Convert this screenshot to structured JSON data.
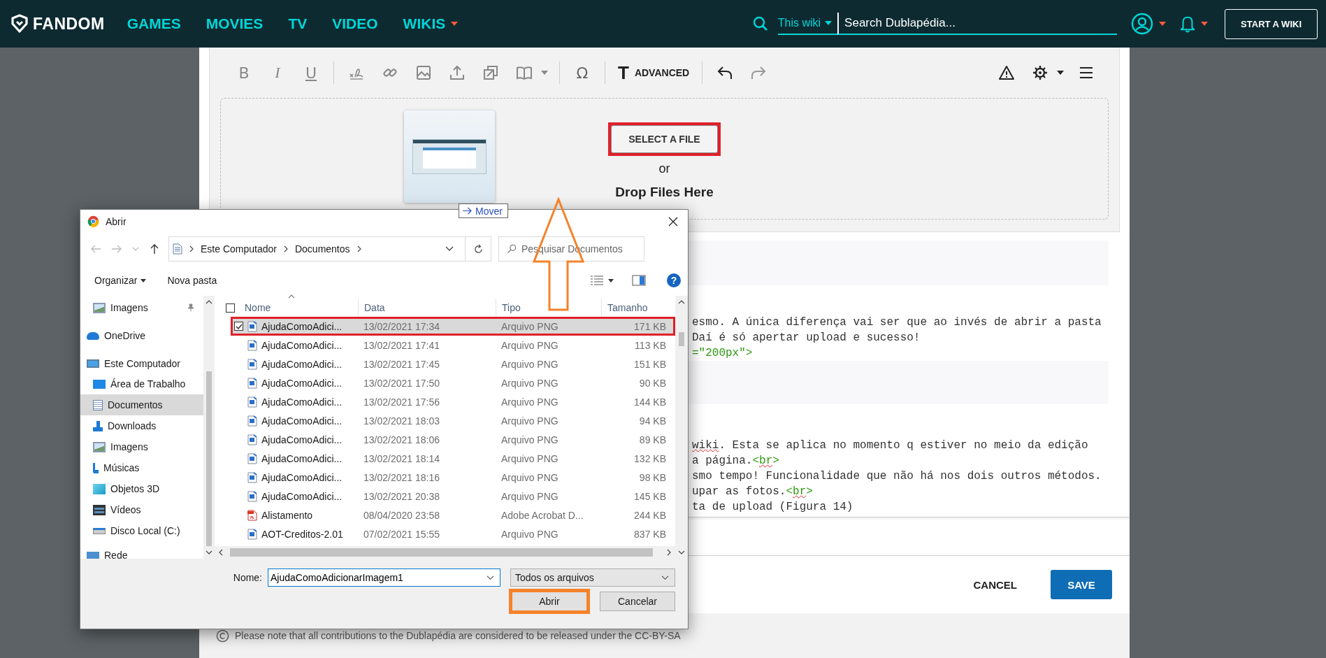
{
  "nav": {
    "logo": "FANDOM",
    "links": [
      {
        "label": "GAMES",
        "dropdown": false
      },
      {
        "label": "MOVIES",
        "dropdown": false
      },
      {
        "label": "TV",
        "dropdown": false
      },
      {
        "label": "VIDEO",
        "dropdown": false
      },
      {
        "label": "WIKIS",
        "dropdown": true
      }
    ],
    "search_scope": "This wiki",
    "search_placeholder": "Search Dublapédia...",
    "start_button": "START A WIKI"
  },
  "toolbar": {
    "format": [
      {
        "label": "B",
        "kind": "bold"
      },
      {
        "label": "I",
        "kind": "italic"
      },
      {
        "label": "U",
        "kind": "underline"
      }
    ],
    "special": "Ω",
    "advanced_icon": "T",
    "advanced": "ADVANCED"
  },
  "upload": {
    "button": "SELECT A FILE",
    "highlighted": true,
    "or": "or",
    "drop": "Drop Files Here",
    "drag_tooltip": "Mover"
  },
  "editor": {
    "groups": [
      [
        {
          "segments": [
            {
              "text": "esmo. A única diferença vai ser que ao invés de abrir a pasta",
              "kind": "plain"
            }
          ]
        },
        {
          "segments": [
            {
              "text": "Daí é só apertar upload e sucesso!",
              "kind": "plain"
            }
          ]
        },
        {
          "segments": [
            {
              "text": "=\"200px\">",
              "kind": "tag"
            }
          ]
        }
      ],
      [
        {
          "segments": [
            {
              "text": "wiki",
              "kind": "misspelled"
            },
            {
              "text": ". Esta se aplica no momento q estiver no meio da edição",
              "kind": "plain"
            }
          ]
        },
        {
          "segments": [
            {
              "text": "a página.",
              "kind": "plain"
            },
            {
              "text": "<",
              "kind": "tag"
            },
            {
              "text": "br",
              "kind": "tag-misspelled"
            },
            {
              "text": ">",
              "kind": "tag"
            }
          ]
        },
        {
          "segments": [
            {
              "text": "smo tempo! Funcionalidade que não há nos dois outros métodos.",
              "kind": "plain"
            }
          ]
        },
        {
          "segments": [
            {
              "text": "upar as fotos.",
              "kind": "plain"
            },
            {
              "text": "<",
              "kind": "tag"
            },
            {
              "text": "br",
              "kind": "tag-misspelled"
            },
            {
              "text": ">",
              "kind": "tag"
            }
          ]
        },
        {
          "segments": [
            {
              "text": "ta de upload (Figura 14)",
              "kind": "plain"
            }
          ]
        }
      ]
    ]
  },
  "actions": {
    "cancel": "CANCEL",
    "save": "SAVE"
  },
  "legal": "Please note that all contributions to the Dublapédia are considered to be released under the CC-BY-SA",
  "dialog": {
    "title": "Abrir",
    "breadcrumb": [
      "Este Computador",
      "Documentos"
    ],
    "search_placeholder": "Pesquisar Documentos",
    "commands": [
      {
        "label": "Organizar",
        "dropdown": true
      },
      {
        "label": "Nova pasta",
        "dropdown": false
      }
    ],
    "help": "?",
    "nav_pane": [
      {
        "label": "Imagens",
        "kind": "pictures",
        "pinned": true,
        "selected": false
      },
      {
        "label": "OneDrive",
        "kind": "cloud",
        "pinned": false,
        "selected": false
      },
      {
        "label": "Este Computador",
        "kind": "computer",
        "pinned": false,
        "selected": false,
        "children": [
          {
            "label": "Área de Trabalho",
            "kind": "desktop",
            "selected": false
          },
          {
            "label": "Documentos",
            "kind": "documents",
            "selected": true
          },
          {
            "label": "Downloads",
            "kind": "downloads",
            "selected": false
          },
          {
            "label": "Imagens",
            "kind": "pictures",
            "selected": false
          },
          {
            "label": "Músicas",
            "kind": "music",
            "selected": false
          },
          {
            "label": "Objetos 3D",
            "kind": "objects3d",
            "selected": false
          },
          {
            "label": "Vídeos",
            "kind": "videos",
            "selected": false
          },
          {
            "label": "Disco Local (C:)",
            "kind": "disk",
            "selected": false
          }
        ]
      },
      {
        "label": "Rede",
        "kind": "network",
        "pinned": false,
        "selected": false
      }
    ],
    "columns": [
      "Nome",
      "Data",
      "Tipo",
      "Tamanho"
    ],
    "select_all_checked": false,
    "files": [
      {
        "name": "AjudaComoAdici...",
        "date": "13/02/2021 17:34",
        "type": "Arquivo PNG",
        "size": "171 KB",
        "kind": "png",
        "selected": true
      },
      {
        "name": "AjudaComoAdici...",
        "date": "13/02/2021 17:41",
        "type": "Arquivo PNG",
        "size": "113 KB",
        "kind": "png",
        "selected": false
      },
      {
        "name": "AjudaComoAdici...",
        "date": "13/02/2021 17:45",
        "type": "Arquivo PNG",
        "size": "151 KB",
        "kind": "png",
        "selected": false
      },
      {
        "name": "AjudaComoAdici...",
        "date": "13/02/2021 17:50",
        "type": "Arquivo PNG",
        "size": "90 KB",
        "kind": "png",
        "selected": false
      },
      {
        "name": "AjudaComoAdici...",
        "date": "13/02/2021 17:56",
        "type": "Arquivo PNG",
        "size": "144 KB",
        "kind": "png",
        "selected": false
      },
      {
        "name": "AjudaComoAdici...",
        "date": "13/02/2021 18:03",
        "type": "Arquivo PNG",
        "size": "94 KB",
        "kind": "png",
        "selected": false
      },
      {
        "name": "AjudaComoAdici...",
        "date": "13/02/2021 18:06",
        "type": "Arquivo PNG",
        "size": "89 KB",
        "kind": "png",
        "selected": false
      },
      {
        "name": "AjudaComoAdici...",
        "date": "13/02/2021 18:14",
        "type": "Arquivo PNG",
        "size": "132 KB",
        "kind": "png",
        "selected": false
      },
      {
        "name": "AjudaComoAdici...",
        "date": "13/02/2021 18:16",
        "type": "Arquivo PNG",
        "size": "98 KB",
        "kind": "png",
        "selected": false
      },
      {
        "name": "AjudaComoAdici...",
        "date": "13/02/2021 20:38",
        "type": "Arquivo PNG",
        "size": "145 KB",
        "kind": "png",
        "selected": false
      },
      {
        "name": "Alistamento",
        "date": "08/04/2020 23:58",
        "type": "Adobe Acrobat D...",
        "size": "244 KB",
        "kind": "pdf",
        "selected": false
      },
      {
        "name": "AOT-Creditos-2.01",
        "date": "07/02/2021 15:55",
        "type": "Arquivo PNG",
        "size": "837 KB",
        "kind": "png",
        "selected": false
      }
    ],
    "filename_label": "Nome:",
    "filename": "AjudaComoAdicionarImagem1",
    "filter": "Todos os arquivos",
    "buttons": [
      {
        "label": "Abrir",
        "highlighted": true
      },
      {
        "label": "Cancelar",
        "highlighted": false
      }
    ]
  }
}
